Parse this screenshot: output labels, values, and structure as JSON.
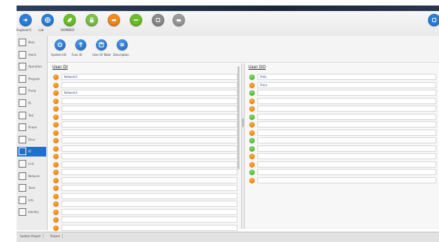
{
  "window": {
    "title": ""
  },
  "toolbar": {
    "items": [
      {
        "label": "Engineer/1",
        "icon": "logout-icon",
        "color": "#2b7fd9"
      },
      {
        "label": "Lab",
        "icon": "globe-icon",
        "color": "#2b7fd9"
      },
      {
        "label": "DISMBIED",
        "icon": "leaf-icon",
        "color": "#6cbf2a"
      },
      {
        "label": "",
        "icon": "lock-icon",
        "color": "#7cc24a"
      },
      {
        "label": "",
        "icon": "tool-icon",
        "color": "#f08a1c"
      },
      {
        "label": "",
        "icon": "flow-icon",
        "color": "#6cbf2a"
      },
      {
        "label": "",
        "icon": "bell-icon",
        "color": "#8a8a8a"
      },
      {
        "label": "",
        "icon": "print-icon",
        "color": "#9a9a9a"
      }
    ],
    "right_icon": {
      "icon": "help-icon",
      "color": "#2b7fd9"
    }
  },
  "sidebar": {
    "items": [
      {
        "label": "Main",
        "active": false
      },
      {
        "label": "Alerts",
        "active": false
      },
      {
        "label": "Operation",
        "active": false
      },
      {
        "label": "Program",
        "active": false
      },
      {
        "label": "Pump",
        "active": false
      },
      {
        "label": "PL",
        "active": false
      },
      {
        "label": "Test",
        "active": false
      },
      {
        "label": "Scope",
        "active": false
      },
      {
        "label": "Devs",
        "active": false
      },
      {
        "label": "IO",
        "active": true
      },
      {
        "label": "Link",
        "active": false
      },
      {
        "label": "Network",
        "active": false
      },
      {
        "label": "Tools",
        "active": false
      },
      {
        "label": "Info",
        "active": false
      },
      {
        "label": "Identity",
        "active": false
      }
    ]
  },
  "subtoolbar": {
    "items": [
      {
        "label": "System I/O",
        "icon": "gear-icon"
      },
      {
        "label": "Func IO",
        "icon": "upload-icon"
      },
      {
        "label": "User IO Table",
        "icon": "save-icon"
      },
      {
        "label": "Description",
        "icon": "list-icon"
      }
    ]
  },
  "left_panel": {
    "title": "User DI",
    "rows": [
      {
        "value": "Network1"
      },
      {
        "value": ""
      },
      {
        "value": "Network1"
      },
      {
        "value": ""
      },
      {
        "value": ""
      },
      {
        "value": ""
      },
      {
        "value": ""
      },
      {
        "value": ""
      },
      {
        "value": ""
      },
      {
        "value": ""
      },
      {
        "value": ""
      },
      {
        "value": ""
      },
      {
        "value": ""
      },
      {
        "value": ""
      },
      {
        "value": ""
      },
      {
        "value": ""
      },
      {
        "value": ""
      },
      {
        "value": ""
      },
      {
        "value": ""
      },
      {
        "value": ""
      }
    ]
  },
  "right_panel": {
    "title": "User DO",
    "rows": [
      {
        "value": "Pmb",
        "status": "green"
      },
      {
        "value": "Pmrn",
        "status": "orange"
      },
      {
        "value": "",
        "status": "green"
      },
      {
        "value": "",
        "status": "orange"
      },
      {
        "value": "",
        "status": "orange"
      },
      {
        "value": "",
        "status": "green"
      },
      {
        "value": "",
        "status": "orange"
      },
      {
        "value": "",
        "status": "orange"
      },
      {
        "value": "",
        "status": "green"
      },
      {
        "value": "",
        "status": "green"
      },
      {
        "value": "",
        "status": "orange"
      },
      {
        "value": "",
        "status": "orange"
      },
      {
        "value": "",
        "status": "green"
      },
      {
        "value": "",
        "status": "orange"
      }
    ]
  },
  "statusbar": {
    "tabs": [
      {
        "label": "System Project"
      },
      {
        "label": "Project"
      }
    ]
  }
}
